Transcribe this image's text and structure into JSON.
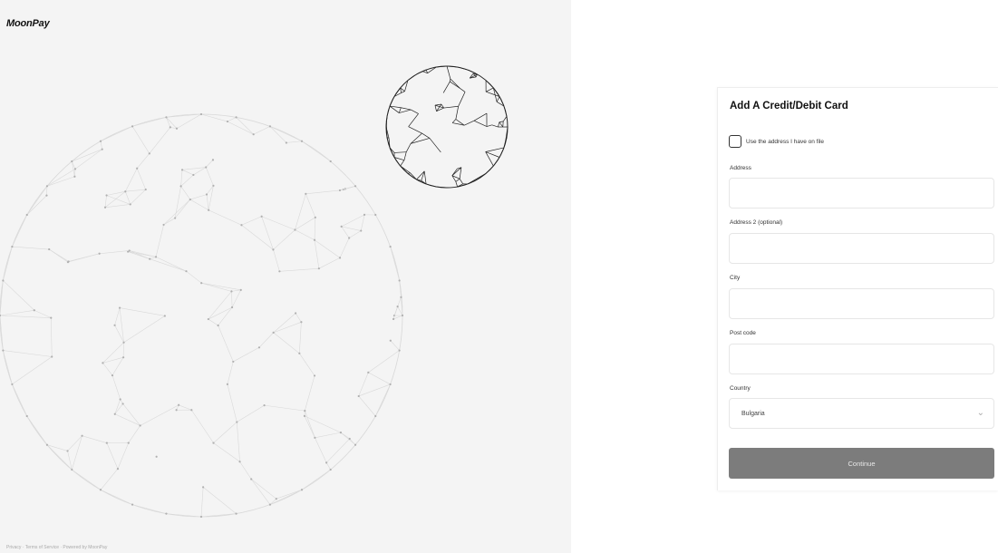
{
  "brand": {
    "logo_text": "MoonPay"
  },
  "footer": {
    "text": "Privacy · Terms of Service · Powered by MoonPay"
  },
  "form": {
    "title": "Add A Credit/Debit Card",
    "use_address_label": "Use the address I have on file",
    "use_address_checked": false,
    "address_label": "Address",
    "address_value": "",
    "address2_label": "Address 2 (optional)",
    "address2_value": "",
    "city_label": "City",
    "city_value": "",
    "postcode_label": "Post code",
    "postcode_value": "",
    "country_label": "Country",
    "country_value": "Bulgaria",
    "continue_label": "Continue"
  },
  "colors": {
    "left_background": "#f4f4f4",
    "button_background": "#7c7c7c",
    "small_globe_stroke": "#222222",
    "large_globe_stroke": "#d9d9d9"
  }
}
